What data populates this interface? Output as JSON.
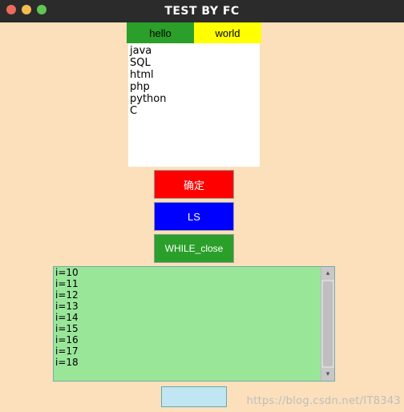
{
  "title": "TEST BY FC",
  "tabs": {
    "hello": "hello",
    "world": "world"
  },
  "list_text": "java\nSQL\nhtml\nphp\npython\nC",
  "buttons": {
    "ok": "确定",
    "ls": "LS",
    "while": "WHILE_close"
  },
  "output_text": "i=10\ni=11\ni=12\ni=13\ni=14\ni=15\ni=16\ni=17\ni=18",
  "textfield_value": "",
  "scrollbar": {
    "up_glyph": "▴",
    "down_glyph": "▾"
  },
  "watermark": "https://blog.csdn.net/IT8343",
  "colors": {
    "titlebar": "#2b2b2b",
    "body": "#fce0bb",
    "tab_hello": "#2aa02a",
    "tab_world": "#ffff00",
    "btn_ok": "#ff0000",
    "btn_ls": "#0000ff",
    "btn_while": "#2aa02a",
    "output_bg": "#99e699",
    "textfield_bg": "#bfe6f2"
  }
}
